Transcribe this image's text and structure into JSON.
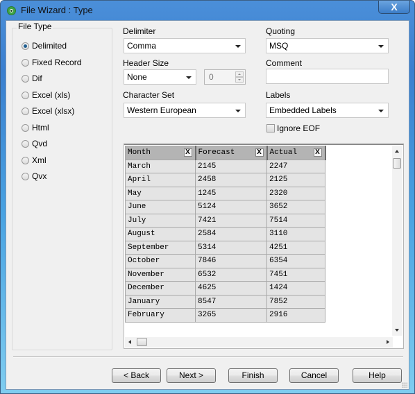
{
  "window": {
    "title": "File Wizard : Type",
    "close_label": "X"
  },
  "file_type": {
    "label": "File Type",
    "selected": "Delimited",
    "options": [
      "Delimited",
      "Fixed Record",
      "Dif",
      "Excel (xls)",
      "Excel (xlsx)",
      "Html",
      "Qvd",
      "Xml",
      "Qvx"
    ]
  },
  "settings": {
    "delimiter": {
      "label": "Delimiter",
      "value": "Comma"
    },
    "header_size": {
      "label": "Header Size",
      "value": "None",
      "spin_value": "0"
    },
    "character_set": {
      "label": "Character Set",
      "value": "Western European"
    },
    "quoting": {
      "label": "Quoting",
      "value": "MSQ"
    },
    "comment": {
      "label": "Comment",
      "value": ""
    },
    "labels": {
      "label": "Labels",
      "value": "Embedded Labels"
    },
    "ignore_eof": {
      "label": "Ignore EOF",
      "checked": false
    }
  },
  "preview": {
    "columns": [
      "Month",
      "Forecast",
      "Actual"
    ],
    "column_remove_label": "X",
    "rows": [
      [
        "March",
        "2145",
        "2247"
      ],
      [
        "April",
        "2458",
        "2125"
      ],
      [
        "May",
        "1245",
        "2320"
      ],
      [
        "June",
        "5124",
        "3652"
      ],
      [
        "July",
        "7421",
        "7514"
      ],
      [
        "August",
        "2584",
        "3110"
      ],
      [
        "September",
        "5314",
        "4251"
      ],
      [
        "October",
        "7846",
        "6354"
      ],
      [
        "November",
        "6532",
        "7451"
      ],
      [
        "December",
        "4625",
        "1424"
      ],
      [
        "January",
        "8547",
        "7852"
      ],
      [
        "February",
        "3265",
        "2916"
      ]
    ]
  },
  "buttons": {
    "back": "< Back",
    "next": "Next >",
    "finish": "Finish",
    "cancel": "Cancel",
    "help": "Help"
  }
}
